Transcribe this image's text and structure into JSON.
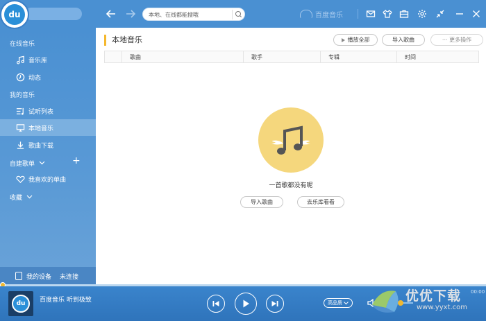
{
  "titlebar": {
    "logo_text": "du",
    "search_placeholder": "本地、在线都能搜哦",
    "brand": "百度音乐"
  },
  "sidebar": {
    "online_section": "在线音乐",
    "items_online": [
      {
        "label": "音乐库",
        "icon": "music-note-icon"
      },
      {
        "label": "动态",
        "icon": "activity-icon"
      }
    ],
    "my_section": "我的音乐",
    "items_my": [
      {
        "label": "试听列表",
        "icon": "playlist-icon"
      },
      {
        "label": "本地音乐",
        "icon": "monitor-icon",
        "active": true
      },
      {
        "label": "歌曲下载",
        "icon": "download-icon"
      }
    ],
    "custom_lists": "自建歌单",
    "add_symbol": "+",
    "favorite": "我喜欢的单曲",
    "collection": "收藏",
    "device": "我的设备",
    "device_status": "未连接"
  },
  "main": {
    "title": "本地音乐",
    "btn_play_all": "播放全部",
    "btn_import": "导入歌曲",
    "btn_more": "··· 更多操作",
    "columns": [
      "歌曲",
      "歌手",
      "专辑",
      "时间"
    ],
    "empty_text": "一首歌都没有呢",
    "empty_import": "导入歌曲",
    "empty_library": "去乐库看看"
  },
  "player": {
    "cover_text": "du",
    "now_playing": "百度音乐 听到极致",
    "quality": "高品质",
    "time": "00:00",
    "volume": 0.6
  },
  "watermark": {
    "text": "优优下载",
    "url": "www.yyxt.com"
  },
  "colors": {
    "primary": "#4a90d2",
    "accent": "#f5b82e",
    "empty_art": "#f5d77d"
  }
}
